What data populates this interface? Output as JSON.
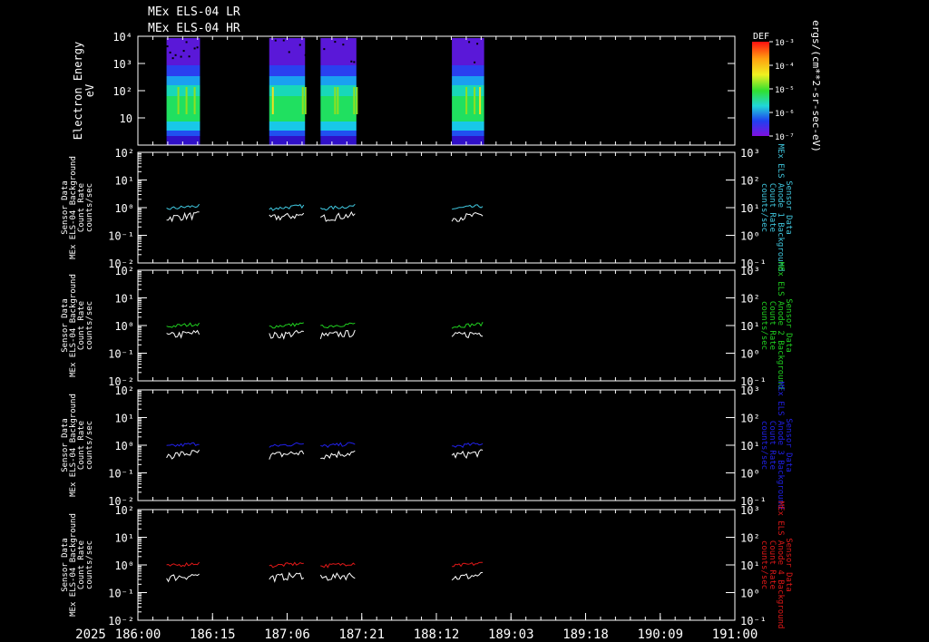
{
  "titles": [
    "MEx ELS-04 LR",
    "MEx ELS-04 HR"
  ],
  "colors": {
    "background": "#000000",
    "axis": "#ffffff",
    "bg_trace": "#ffffff",
    "panel_traces": [
      "#40c8e0",
      "#20d020",
      "#2020e8",
      "#e01818"
    ]
  },
  "colorbar": {
    "label": "DEF",
    "unit": "ergs/(cm**2-sr-sec-eV)",
    "tick_labels": [
      "10⁻³",
      "10⁻⁴",
      "10⁻⁵",
      "10⁻⁶",
      "10⁻⁷"
    ],
    "scale": "log",
    "colormap": "rainbow (violet-low to red-high)"
  },
  "x_axis": {
    "year_label": "2025",
    "tick_labels": [
      "186:00",
      "186:15",
      "187:06",
      "187:21",
      "188:12",
      "189:03",
      "189:18",
      "190:09",
      "191:00"
    ]
  },
  "chart_data": [
    {
      "type": "heatmap",
      "panel": "spectrogram",
      "ylabel": "Electron Energy",
      "yunit": "eV",
      "ytick_labels": [
        "10⁴",
        "10³",
        "10²",
        "10",
        ""
      ],
      "yscale": "log",
      "data_intervals_doy": [
        [
          186.24,
          186.52
        ],
        [
          187.1,
          187.4
        ],
        [
          187.53,
          187.83
        ],
        [
          188.63,
          188.9
        ]
      ],
      "description_values": "energy flux concentrated ~10-300 eV, peak near 20-60 eV"
    },
    {
      "type": "line",
      "panel": "background-1",
      "ylabel": [
        "Sensor Data",
        "MEx ELS-04 Background",
        "Count Rate",
        "counts/sec"
      ],
      "right_label": [
        "Sensor Data",
        "MEx ELS Anode 1 Background",
        "Count Rate",
        "counts/sec"
      ],
      "left_tick_labels": [
        "10²",
        "10¹",
        "10⁰",
        "10⁻¹",
        "10⁻²"
      ],
      "right_tick_labels": [
        "10³",
        "10²",
        "10¹",
        "10⁰",
        "10⁻¹"
      ],
      "yscale": "log",
      "series": [
        {
          "values_level": 0.9,
          "color": "#40c8e0"
        },
        {
          "values_level": 0.5,
          "color": "#ffffff"
        }
      ]
    },
    {
      "type": "line",
      "panel": "background-2",
      "ylabel": [
        "Sensor Data",
        "MEx ELS-04 Background",
        "Count Rate",
        "counts/sec"
      ],
      "right_label": [
        "Sensor Data",
        "MEx ELS Anode 2 Background",
        "Count Rate",
        "counts/sec"
      ],
      "left_tick_labels": [
        "10²",
        "10¹",
        "10⁰",
        "10⁻¹",
        "10⁻²"
      ],
      "right_tick_labels": [
        "10³",
        "10²",
        "10¹",
        "10⁰",
        "10⁻¹"
      ],
      "yscale": "log",
      "series": [
        {
          "values_level": 0.9,
          "color": "#20d020"
        },
        {
          "values_level": 0.5,
          "color": "#ffffff"
        }
      ]
    },
    {
      "type": "line",
      "panel": "background-3",
      "ylabel": [
        "Sensor Data",
        "MEx ELS-04 Background",
        "Count Rate",
        "counts/sec"
      ],
      "right_label": [
        "Sensor Data",
        "MEx ELS Anode 3 Background",
        "Count Rate",
        "counts/sec"
      ],
      "left_tick_labels": [
        "10²",
        "10¹",
        "10⁰",
        "10⁻¹",
        "10⁻²"
      ],
      "right_tick_labels": [
        "10³",
        "10²",
        "10¹",
        "10⁰",
        "10⁻¹"
      ],
      "yscale": "log",
      "series": [
        {
          "values_level": 0.9,
          "color": "#2020e8"
        },
        {
          "values_level": 0.5,
          "color": "#ffffff"
        }
      ]
    },
    {
      "type": "line",
      "panel": "background-4",
      "ylabel": [
        "Sensor Data",
        "MEx ELS-04 Background",
        "Count Rate",
        "counts/sec"
      ],
      "right_label": [
        "Sensor Data",
        "MEx ELS Anode 4 Background",
        "Count Rate",
        "counts/sec"
      ],
      "left_tick_labels": [
        "10²",
        "10¹",
        "10⁰",
        "10⁻¹",
        "10⁻²"
      ],
      "right_tick_labels": [
        "10³",
        "10²",
        "10¹",
        "10⁰",
        "10⁻¹",
        "10⁻²"
      ],
      "yscale": "log",
      "series": [
        {
          "values_level": 0.9,
          "color": "#e01818"
        },
        {
          "values_level": 0.4,
          "color": "#ffffff"
        }
      ]
    }
  ]
}
